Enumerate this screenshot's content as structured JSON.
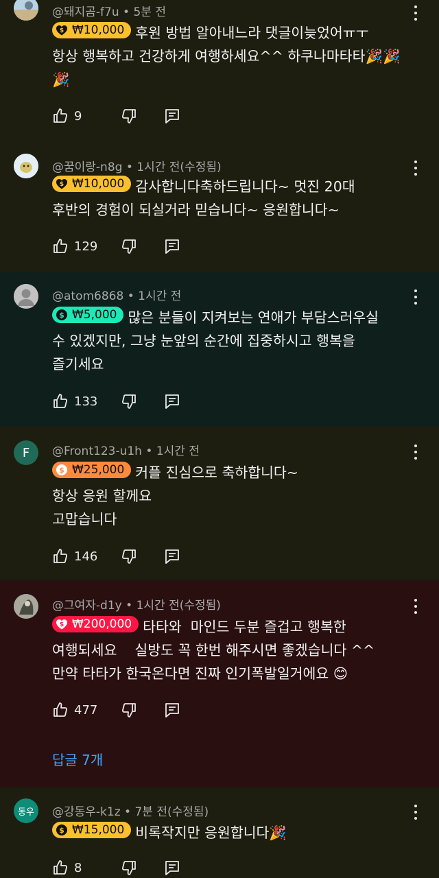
{
  "colors": {
    "bg_default": "#1d1d10",
    "bg_teal": "#0f1f1b",
    "bg_maroon": "#2a0f10",
    "chip_yellow": "#fbc02d",
    "chip_teal": "#1de9b6",
    "chip_orange": "#ff8a3d",
    "chip_red": "#ff1744",
    "link": "#3ea6ff"
  },
  "comments": [
    {
      "author": "@돼지곰-f7u",
      "time": "5분 전",
      "amount": "₩10,000",
      "lines": [
        "후원 방법 알아내느라 댓글이늦었어ㅠㅜ",
        "항상 행복하고 건강하게 여행하세요^^ 하쿠나마타타🎉🎉",
        "🎉"
      ],
      "likes": "9",
      "avatar_icon": "landscape-photo-avatar"
    },
    {
      "author": "@꿈이랑-n8g",
      "time": "1시간 전(수정됨)",
      "amount": "₩10,000",
      "lines": [
        "감사합니다축하드립니다~ 멋진 20대",
        "후반의 경험이 되실거라 믿습니다~ 응원합니다~"
      ],
      "likes": "129",
      "avatar_icon": "cartoon-avatar"
    },
    {
      "author": "@atom6868",
      "time": "1시간 전",
      "amount": "₩5,000",
      "lines": [
        "많은 분들이 지켜보는 연애가 부담스러우실",
        "수 있겠지만, 그냥 눈앞의 순간에 집중하시고 행복을",
        "즐기세요"
      ],
      "likes": "133",
      "avatar_icon": "default-person-avatar"
    },
    {
      "author": "@Front123-u1h",
      "time": "1시간 전",
      "amount": "₩25,000",
      "lines": [
        "커플 진심으로 축하합니다~",
        "항상 응원 할께요",
        "고맙습니다"
      ],
      "likes": "146",
      "avatar_letter": "F"
    },
    {
      "author": "@그여자-d1y",
      "time": "1시간 전(수정됨)",
      "amount": "₩200,000",
      "lines": [
        "타타와  마인드 두분 즐겁고 행복한",
        "여행되세요    실방도 꼭 한번 해주시면 좋겠습니다 ^^",
        "만약 타타가 한국온다면 진짜 인기폭발일거에요 😊"
      ],
      "likes": "477",
      "replies": "답글 7개",
      "avatar_icon": "photo-avatar"
    },
    {
      "author": "@강동우-k1z",
      "time": "7분 전(수정됨)",
      "amount": "₩15,000",
      "lines": [
        "비록작지만 응원합니다🎉"
      ],
      "likes": "8",
      "avatar_letter": "동우"
    }
  ]
}
